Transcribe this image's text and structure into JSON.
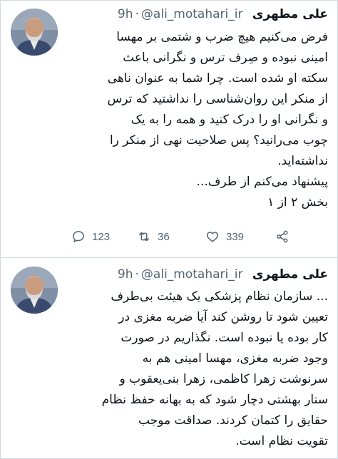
{
  "tweets": [
    {
      "author_name": "علی مطهری",
      "handle": "@ali_motahari_ir",
      "separator": "·",
      "time": "9h",
      "lines": [
        "فرض می‌کنیم هیچ ضرب و شتمی بر مهسا",
        "امینی نبوده و صِرف ترس و نگرانی باعث",
        "سکته او شده است. چرا شما به عنوان ناهی",
        "از منکر این روان‌شناسی را نداشتید که ترس",
        "و نگرانی او را درک کنید و همه را به یک",
        "چوب می‌رانید؟ پس صلاحیت نهی از منکر را",
        "نداشته‌اید.",
        "پیشنهاد می‌کنم از طرف...",
        "بخش ۲ از ۱"
      ],
      "actions": {
        "reply_count": "123",
        "retweet_count": "36",
        "like_count": "339"
      },
      "icons": [
        "reply-icon",
        "retweet-icon",
        "like-icon",
        "share-icon"
      ]
    },
    {
      "author_name": "علی مطهری",
      "handle": "@ali_motahari_ir",
      "separator": "·",
      "time": "9h",
      "lines": [
        "... سازمان نظام پزشکی یک هیئت بی‌طرف",
        "تعیین شود تا روشن کند آیا ضربه مغزی در",
        "کار بوده یا نبوده است. نگذاریم در صورت",
        "وجود ضربه مغزی، مهسا امینی هم به",
        "سرنوشت زهرا کاظمی، زهرا بنی‌یعقوب و",
        "ستار بهشتی دچار شود که به بهانه حفظ نظام",
        "حقایق را کتمان کردند. صداقت موجب",
        "تقویت نظام است."
      ]
    }
  ],
  "colors": {
    "text": "#0f1419",
    "secondary": "#536471",
    "border": "#cfd9de",
    "background": "#ffffff"
  }
}
